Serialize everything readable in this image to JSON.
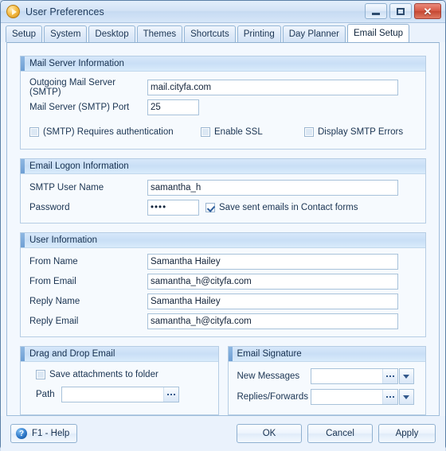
{
  "window": {
    "title": "User Preferences",
    "app_icon": "play-circle-icon",
    "controls": {
      "minimize": "minimize-icon",
      "maximize": "maximize-icon",
      "close": "✕"
    }
  },
  "tabs": [
    {
      "label": "Setup",
      "active": false
    },
    {
      "label": "System",
      "active": false
    },
    {
      "label": "Desktop",
      "active": false
    },
    {
      "label": "Themes",
      "active": false
    },
    {
      "label": "Shortcuts",
      "active": false
    },
    {
      "label": "Printing",
      "active": false
    },
    {
      "label": "Day Planner",
      "active": false
    },
    {
      "label": "Email Setup",
      "active": true
    }
  ],
  "mail_server": {
    "header": "Mail Server Information",
    "outgoing_label": "Outgoing Mail Server (SMTP)",
    "outgoing_value": "mail.cityfa.com",
    "port_label": "Mail Server (SMTP) Port",
    "port_value": "25",
    "checkboxes": [
      {
        "label": "(SMTP) Requires authentication",
        "checked": false
      },
      {
        "label": "Enable SSL",
        "checked": false
      },
      {
        "label": "Display SMTP Errors",
        "checked": false
      }
    ]
  },
  "email_logon": {
    "header": "Email Logon Information",
    "username_label": "SMTP User Name",
    "username_value": "samantha_h",
    "password_label": "Password",
    "password_value": "••••",
    "save_sent_label": "Save sent emails in Contact forms",
    "save_sent_checked": true
  },
  "user_information": {
    "header": "User Information",
    "fields": [
      {
        "label": "From Name",
        "value": "Samantha Hailey"
      },
      {
        "label": "From Email",
        "value": "samantha_h@cityfa.com"
      },
      {
        "label": "Reply Name",
        "value": "Samantha Hailey"
      },
      {
        "label": "Reply Email",
        "value": "samantha_h@cityfa.com"
      }
    ]
  },
  "drag_drop": {
    "header": "Drag and Drop Email",
    "save_attachments_label": "Save attachments to folder",
    "save_attachments_checked": false,
    "path_label": "Path",
    "path_value": "",
    "browse_icon": "ellipsis-icon"
  },
  "signature": {
    "header": "Email Signature",
    "rows": [
      {
        "label": "New Messages",
        "value": ""
      },
      {
        "label": "Replies/Forwards",
        "value": ""
      }
    ],
    "browse_icon": "ellipsis-icon",
    "dropdown_icon": "chevron-down-icon"
  },
  "footer": {
    "help_label": "F1 - Help",
    "help_icon": "question-mark-icon",
    "ok_label": "OK",
    "cancel_label": "Cancel",
    "apply_label": "Apply"
  },
  "colors": {
    "accent": "#6e9fd4",
    "group_header": "#c9dff6",
    "close_button": "#c44732",
    "window_bg": "#eef4fc",
    "page_bg": "#f3f8fe"
  }
}
